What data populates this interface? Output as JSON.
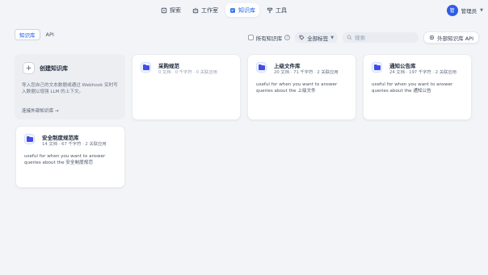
{
  "nav": {
    "items": [
      {
        "label": "探索",
        "icon": "compass-icon"
      },
      {
        "label": "工作室",
        "icon": "robot-icon"
      },
      {
        "label": "知识库",
        "icon": "book-icon",
        "active": true
      },
      {
        "label": "工具",
        "icon": "hammer-icon"
      }
    ]
  },
  "user": {
    "avatar_text": "管",
    "name": "管理员"
  },
  "tabs": [
    {
      "label": "知识库",
      "active": true
    },
    {
      "label": "API",
      "active": false
    }
  ],
  "toolbar": {
    "all_kb_label": "所有知识库",
    "tag_filter_label": "全部标签",
    "search_placeholder": "搜索",
    "api_button_label": "外部知识库 API"
  },
  "create_card": {
    "title": "创建知识库",
    "description": "导入您自己的文本数据或通过 Webhook 实时写入数据以增强 LLM 的上下文。",
    "link": "连接外部知识库 →"
  },
  "knowledge_bases": [
    {
      "name": "采购规范",
      "meta": "0 文档 · 0 千字符 · 0 关联应用",
      "description": ""
    },
    {
      "name": "上级文件库",
      "meta": "20 文档 · 71 千字符 · 2 关联应用",
      "description": "useful for when you want to answer queries about the 上级文件"
    },
    {
      "name": "通知公告库",
      "meta": "24 文档 · 197 千字符 · 2 关联应用",
      "description": "useful for when you want to answer queries about the 通知公告"
    },
    {
      "name": "安全制度规范库",
      "meta": "14 文档 · 67 千字符 · 2 关联应用",
      "description": "useful for when you want to answer queries about the 安全制度规范"
    }
  ],
  "colors": {
    "accent": "#155eef",
    "avatar": "#2e5ce8",
    "folder": "#444ce7"
  }
}
